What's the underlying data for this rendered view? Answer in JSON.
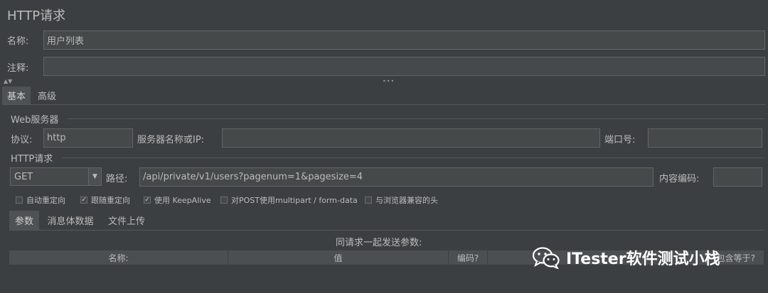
{
  "window": {
    "title": "HTTP请求"
  },
  "name_field": {
    "label": "名称:",
    "value": "用户列表"
  },
  "comment_field": {
    "label": "注释:",
    "value": ""
  },
  "tabs": [
    {
      "label": "基本"
    },
    {
      "label": "高级"
    }
  ],
  "web_server": {
    "section_title": "Web服务器",
    "protocol_label": "协议:",
    "protocol_value": "http",
    "server_label": "服务器名称或IP:",
    "server_value": "",
    "port_label": "端口号:",
    "port_value": ""
  },
  "http_request": {
    "section_title": "HTTP请求",
    "method": "GET",
    "path_label": "路径:",
    "path_value": "/api/private/v1/users?pagenum=1&pagesize=4",
    "encoding_label": "内容编码:",
    "encoding_value": ""
  },
  "options": [
    {
      "label": "自动重定向",
      "checked": false
    },
    {
      "label": "跟随重定向",
      "checked": true
    },
    {
      "label": "使用 KeepAlive",
      "checked": true
    },
    {
      "label": "对POST使用multipart / form-data",
      "checked": false
    },
    {
      "label": "与浏览器兼容的头",
      "checked": false
    }
  ],
  "sub_tabs": [
    {
      "label": "参数"
    },
    {
      "label": "消息体数据"
    },
    {
      "label": "文件上传"
    }
  ],
  "params": {
    "caption": "同请求一起发送参数:",
    "columns": [
      "名称:",
      "值",
      "编码?",
      "包含等于?"
    ]
  },
  "watermark": {
    "text": "ITester软件测试小栈"
  }
}
